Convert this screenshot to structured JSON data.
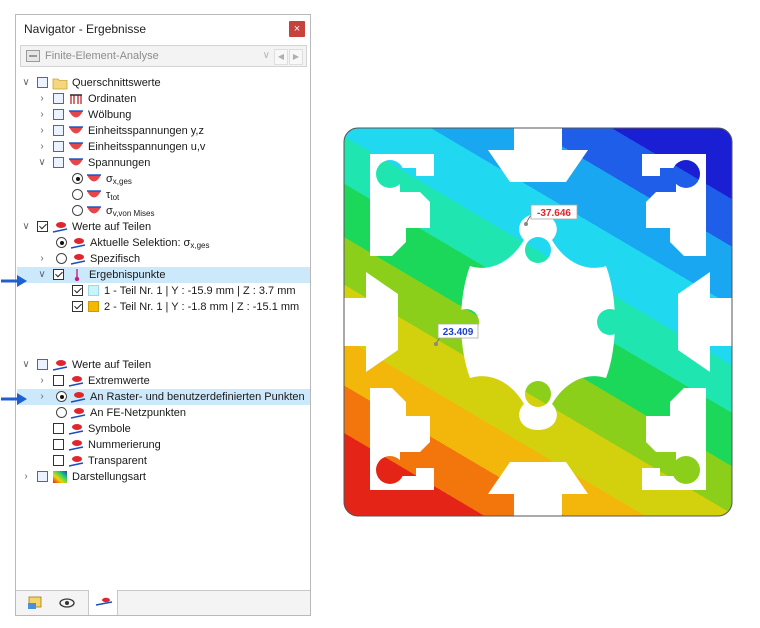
{
  "navigator": {
    "title": "Navigator - Ergebnisse",
    "close_label": "×",
    "module_select": {
      "value": "Finite-Element-Analyse"
    }
  },
  "tree": {
    "querschnittswerte": "Querschnittswerte",
    "ordinaten": "Ordinaten",
    "woelbung": "Wölbung",
    "einheit_yz": "Einheitsspannungen y,z",
    "einheit_uv": "Einheitsspannungen u,v",
    "spannungen": "Spannungen",
    "sigma_main": "σ",
    "sigma_sub": "x,ges",
    "tau_main": "τ",
    "tau_sub": "tot",
    "sigmav_main": "σ",
    "sigmav_sub": "v,von Mises",
    "werte1": "Werte auf Teilen",
    "aktuelle_main": "Aktuelle Selektion: σ",
    "aktuelle_sub": "x,ges",
    "spezifisch": "Spezifisch",
    "ergebnispunkte": "Ergebnispunkte",
    "point1": "1 - Teil Nr. 1 | Y : -15.9 mm | Z : 3.7 mm",
    "point2": "2 - Teil Nr. 1 | Y : -1.8 mm | Z : -15.1 mm",
    "werte2": "Werte auf Teilen",
    "extremwerte": "Extremwerte",
    "raster": "An Raster- und benutzerdefinierten Punkten",
    "fe_netz": "An FE-Netzpunkten",
    "symbole": "Symbole",
    "nummerierung": "Nummerierung",
    "transparent": "Transparent",
    "darstellungsart": "Darstellungsart"
  },
  "labels": {
    "value_top": "-37.646",
    "value_left": "23.409"
  },
  "colors": {
    "highlight": "#cce8fb",
    "arrow": "#1f5fd0",
    "point1": "#c8f4fb",
    "point2": "#f5b800",
    "value_top": "#e0262d",
    "value_left": "#1a3fd0"
  },
  "icons": {
    "folder": "folder-icon",
    "ordinates": "ordinates-icon",
    "stress": "stress-diagram-icon",
    "values": "values-on-parts-icon",
    "result_point": "result-point-icon",
    "display": "display-mode-icon"
  }
}
